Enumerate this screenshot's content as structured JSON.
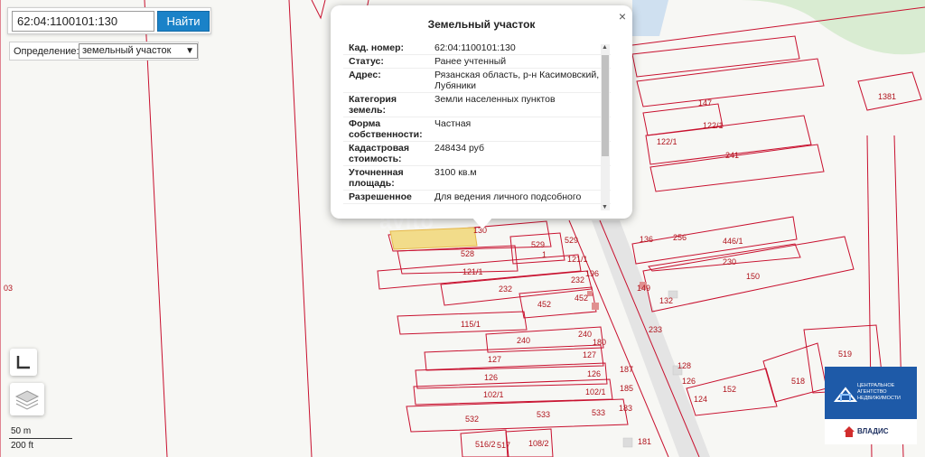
{
  "search": {
    "value": "62:04:1100101:130",
    "button_label": "Найти"
  },
  "definition": {
    "label": "Определение:",
    "selected": "земельный участок"
  },
  "popup": {
    "title": "Земельный участок",
    "close_label": "×",
    "rows": [
      {
        "key": "Кад. номер:",
        "value": "62:04:1100101:130"
      },
      {
        "key": "Статус:",
        "value": "Ранее учтенный"
      },
      {
        "key": "Адрес:",
        "value": "Рязанская область, р-н Касимовский, с Лубяники"
      },
      {
        "key": "Категория земель:",
        "value": "Земли населенных пунктов"
      },
      {
        "key": "Форма собственности:",
        "value": "Частная"
      },
      {
        "key": "Кадастровая стоимость:",
        "value": "248434 руб"
      },
      {
        "key": "Уточненная площадь:",
        "value": "3100 кв.м"
      },
      {
        "key": "Разрешенное",
        "value": "Для ведения личного подсобного"
      }
    ]
  },
  "scale": {
    "metric": "50 m",
    "imperial": "200 ft"
  },
  "brand": {
    "tagline": "ЦЕНТРАЛЬНОЕ АГЕНТСТВО НЕДВИЖИМОСТИ",
    "name": "ВЛАДИС"
  },
  "icons": {
    "layers": "layers-icon",
    "measure": "measure-icon",
    "home": "home-icon"
  },
  "colors": {
    "parcel_line": "#c8102e",
    "selected_parcel": "#f2dc8a",
    "road": "#d8d8d8",
    "accent": "#1a82c8",
    "brand": "#1e5aa8"
  },
  "map": {
    "parcel_labels": [
      "130",
      "528",
      "529",
      "529",
      "121/1",
      "121/1",
      "232",
      "232",
      "452",
      "452",
      "115/1",
      "240",
      "240",
      "127",
      "127",
      "126",
      "126",
      "102/1",
      "102/1",
      "532",
      "533",
      "533",
      "516/2",
      "517",
      "108/2",
      "147",
      "122/1",
      "122/1",
      "241",
      "1381",
      "256",
      "446/1",
      "230",
      "150",
      "149",
      "132",
      "233",
      "136",
      "519",
      "518",
      "152",
      "128",
      "126",
      "124",
      "183",
      "181",
      "187",
      "185",
      "180",
      "196",
      "03",
      "1"
    ]
  }
}
